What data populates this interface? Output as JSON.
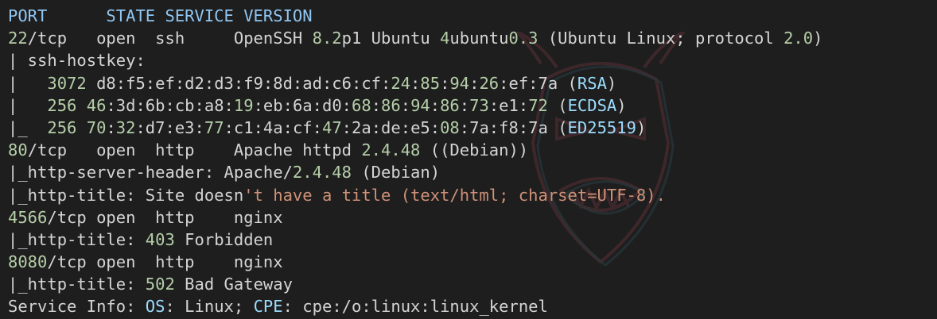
{
  "terminal": {
    "lines": [
      [
        {
          "t": "PORT      STATE SERVICE VERSION",
          "c": "c-head"
        }
      ],
      [
        {
          "t": "22",
          "c": "c-num"
        },
        {
          "t": "/tcp   open  ssh     OpenSSH ",
          "c": "c-txt"
        },
        {
          "t": "8.2",
          "c": "c-num"
        },
        {
          "t": "p1 Ubuntu ",
          "c": "c-txt"
        },
        {
          "t": "4",
          "c": "c-num"
        },
        {
          "t": "ubuntu",
          "c": "c-txt"
        },
        {
          "t": "0.3",
          "c": "c-num"
        },
        {
          "t": " (Ubuntu Linux; protocol ",
          "c": "c-txt"
        },
        {
          "t": "2.0",
          "c": "c-num"
        },
        {
          "t": ")",
          "c": "c-txt"
        }
      ],
      [
        {
          "t": "| ssh-hostkey:",
          "c": "c-txt"
        }
      ],
      [
        {
          "t": "|   ",
          "c": "c-txt"
        },
        {
          "t": "3072",
          "c": "c-num"
        },
        {
          "t": " d8:f5:ef:d2:d3:f9:8d:ad:c6:cf:",
          "c": "c-txt"
        },
        {
          "t": "24",
          "c": "c-num"
        },
        {
          "t": ":",
          "c": "c-txt"
        },
        {
          "t": "85",
          "c": "c-num"
        },
        {
          "t": ":",
          "c": "c-txt"
        },
        {
          "t": "94",
          "c": "c-num"
        },
        {
          "t": ":",
          "c": "c-txt"
        },
        {
          "t": "26",
          "c": "c-num"
        },
        {
          "t": ":ef:7a (",
          "c": "c-txt"
        },
        {
          "t": "RSA",
          "c": "c-kw"
        },
        {
          "t": ")",
          "c": "c-txt"
        }
      ],
      [
        {
          "t": "|   ",
          "c": "c-txt"
        },
        {
          "t": "256",
          "c": "c-num"
        },
        {
          "t": " ",
          "c": "c-txt"
        },
        {
          "t": "46",
          "c": "c-num"
        },
        {
          "t": ":3d:6b:cb:a8:",
          "c": "c-txt"
        },
        {
          "t": "19",
          "c": "c-num"
        },
        {
          "t": ":eb:6a:d0:",
          "c": "c-txt"
        },
        {
          "t": "68",
          "c": "c-num"
        },
        {
          "t": ":",
          "c": "c-txt"
        },
        {
          "t": "86",
          "c": "c-num"
        },
        {
          "t": ":",
          "c": "c-txt"
        },
        {
          "t": "94",
          "c": "c-num"
        },
        {
          "t": ":",
          "c": "c-txt"
        },
        {
          "t": "86",
          "c": "c-num"
        },
        {
          "t": ":",
          "c": "c-txt"
        },
        {
          "t": "73",
          "c": "c-num"
        },
        {
          "t": ":e1:",
          "c": "c-txt"
        },
        {
          "t": "72",
          "c": "c-num"
        },
        {
          "t": " (",
          "c": "c-txt"
        },
        {
          "t": "ECDSA",
          "c": "c-kw"
        },
        {
          "t": ")",
          "c": "c-txt"
        }
      ],
      [
        {
          "t": "|_  ",
          "c": "c-txt"
        },
        {
          "t": "256",
          "c": "c-num"
        },
        {
          "t": " ",
          "c": "c-txt"
        },
        {
          "t": "70",
          "c": "c-num"
        },
        {
          "t": ":",
          "c": "c-txt"
        },
        {
          "t": "32",
          "c": "c-num"
        },
        {
          "t": ":d7:e3:",
          "c": "c-txt"
        },
        {
          "t": "77",
          "c": "c-num"
        },
        {
          "t": ":c1:4a:cf:",
          "c": "c-txt"
        },
        {
          "t": "47",
          "c": "c-num"
        },
        {
          "t": ":2a:de:e5:",
          "c": "c-txt"
        },
        {
          "t": "08",
          "c": "c-num"
        },
        {
          "t": ":7a:f8:7a (",
          "c": "c-txt"
        },
        {
          "t": "ED25519",
          "c": "c-kw"
        },
        {
          "t": ")",
          "c": "c-txt"
        }
      ],
      [
        {
          "t": "80",
          "c": "c-num"
        },
        {
          "t": "/tcp   open  http    Apache httpd ",
          "c": "c-txt"
        },
        {
          "t": "2.4.48",
          "c": "c-num"
        },
        {
          "t": " ((Debian))",
          "c": "c-txt"
        }
      ],
      [
        {
          "t": "|_http-server-header: Apache/",
          "c": "c-txt"
        },
        {
          "t": "2.4.48",
          "c": "c-num"
        },
        {
          "t": " (Debian)",
          "c": "c-txt"
        }
      ],
      [
        {
          "t": "|_http-title: Site doesn",
          "c": "c-txt"
        },
        {
          "t": "'t have a title (text/html; charset=UTF-8).",
          "c": "c-str"
        }
      ],
      [
        {
          "t": "4566",
          "c": "c-num"
        },
        {
          "t": "/tcp open  http    nginx",
          "c": "c-txt"
        }
      ],
      [
        {
          "t": "|_http-title: ",
          "c": "c-txt"
        },
        {
          "t": "403",
          "c": "c-num"
        },
        {
          "t": " Forbidden",
          "c": "c-txt"
        }
      ],
      [
        {
          "t": "8080",
          "c": "c-num"
        },
        {
          "t": "/tcp open  http    nginx",
          "c": "c-txt"
        }
      ],
      [
        {
          "t": "|_http-title: ",
          "c": "c-txt"
        },
        {
          "t": "502",
          "c": "c-num"
        },
        {
          "t": " Bad Gateway",
          "c": "c-txt"
        }
      ],
      [
        {
          "t": "Service Info: ",
          "c": "c-txt"
        },
        {
          "t": "OS",
          "c": "c-kw"
        },
        {
          "t": ": Linux; ",
          "c": "c-txt"
        },
        {
          "t": "CPE",
          "c": "c-kw"
        },
        {
          "t": ": cpe:/o:linux:linux_kernel",
          "c": "c-txt"
        }
      ]
    ]
  },
  "watermark": {
    "icon": "oni-mask-icon",
    "colors": [
      "#b04a55",
      "#4a8fa8"
    ]
  }
}
